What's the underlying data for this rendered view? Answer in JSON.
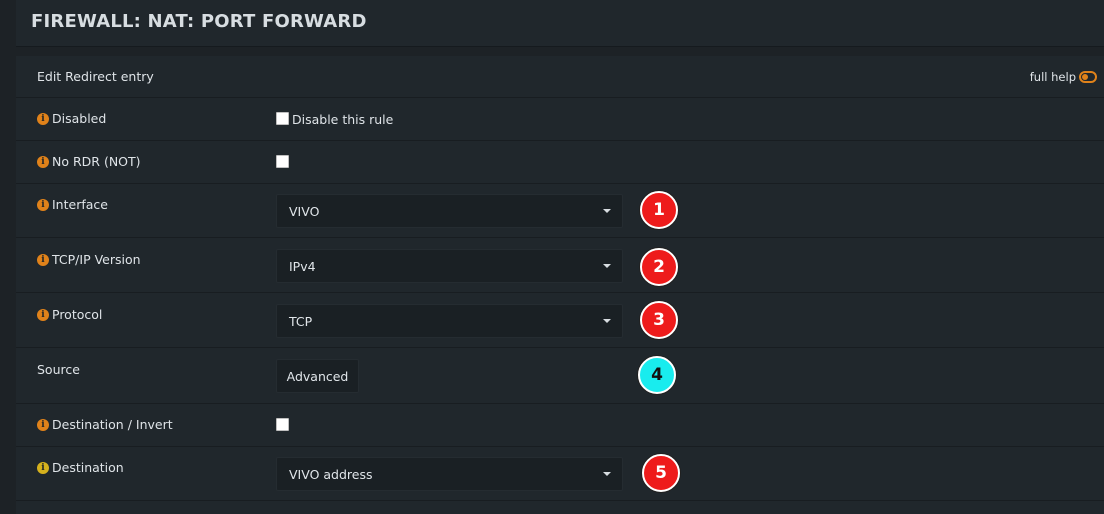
{
  "header": {
    "title": "FIREWALL: NAT: PORT FORWARD"
  },
  "panel": {
    "heading": "Edit Redirect entry",
    "full_help_label": "full help"
  },
  "rows": {
    "disabled": {
      "label": "Disabled",
      "checkbox_label": "Disable this rule",
      "checked": false
    },
    "nordr": {
      "label": "No RDR (NOT)",
      "checked": false
    },
    "interface": {
      "label": "Interface",
      "value": "VIVO"
    },
    "tcpip_version": {
      "label": "TCP/IP Version",
      "value": "IPv4"
    },
    "protocol": {
      "label": "Protocol",
      "value": "TCP"
    },
    "source": {
      "label": "Source",
      "button_label": "Advanced"
    },
    "destination_invert": {
      "label": "Destination / Invert",
      "checked": false
    },
    "destination": {
      "label": "Destination",
      "value": "VIVO address"
    }
  },
  "markers": [
    "1",
    "2",
    "3",
    "4",
    "5"
  ],
  "colors": {
    "marker_red": "#ee1b1b",
    "marker_cyan": "#19ecee",
    "info_orange": "#e0821a",
    "info_yellow": "#d5b11d"
  },
  "icons": {
    "info": "i",
    "toggle": "toggle-icon",
    "caret": "chevron-down-icon"
  }
}
